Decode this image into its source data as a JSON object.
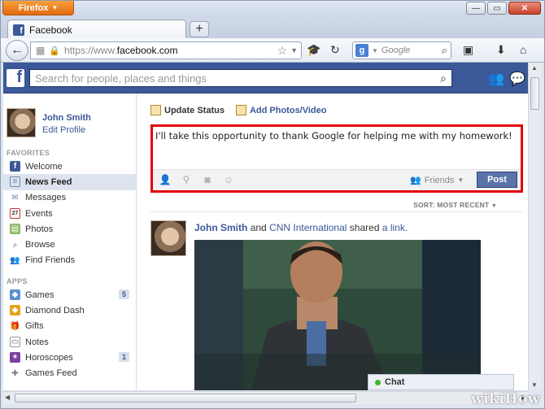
{
  "browser": {
    "menu_label": "Firefox",
    "tab_title": "Facebook",
    "new_tab_label": "+",
    "url_scheme": "https://www.",
    "url_domain": "facebook.com",
    "search_engine_placeholder": "Google"
  },
  "facebook": {
    "search_placeholder": "Search for people, places and things",
    "user": {
      "name": "John Smith",
      "edit_profile": "Edit Profile"
    },
    "favorites_title": "FAVORITES",
    "favorites": [
      {
        "label": "Welcome",
        "icon": "facebook-icon",
        "color": "#3b5998"
      },
      {
        "label": "News Feed",
        "icon": "news-feed-icon",
        "active": true
      },
      {
        "label": "Messages",
        "icon": "messages-icon"
      },
      {
        "label": "Events",
        "icon": "calendar-icon",
        "badge_text": "27"
      },
      {
        "label": "Photos",
        "icon": "photos-icon"
      },
      {
        "label": "Browse",
        "icon": "search-icon"
      },
      {
        "label": "Find Friends",
        "icon": "friends-icon"
      }
    ],
    "apps_title": "APPS",
    "apps": [
      {
        "label": "Games",
        "icon": "games-icon",
        "count": "5"
      },
      {
        "label": "Diamond Dash",
        "icon": "diamond-dash-icon"
      },
      {
        "label": "Gifts",
        "icon": "gift-icon"
      },
      {
        "label": "Notes",
        "icon": "notes-icon"
      },
      {
        "label": "Horoscopes",
        "icon": "horoscopes-icon",
        "count": "1"
      },
      {
        "label": "Games Feed",
        "icon": "games-feed-icon"
      }
    ],
    "composer": {
      "update_status": "Update Status",
      "add_photos": "Add Photos/Video",
      "text": "I'll take this opportunity to thank Google for helping me with my homework!",
      "audience": "Friends",
      "post_label": "Post"
    },
    "sort_label": "SORT: MOST RECENT",
    "story": {
      "actor": "John Smith",
      "and": "and",
      "partner": "CNN International",
      "shared": "shared",
      "object": "a link."
    },
    "chat_label": "Chat"
  },
  "watermark": "wikiHow",
  "colors": {
    "facebook_blue": "#3b5998",
    "highlight_red": "#e3000f",
    "firefox_orange": "#e26a0f"
  }
}
